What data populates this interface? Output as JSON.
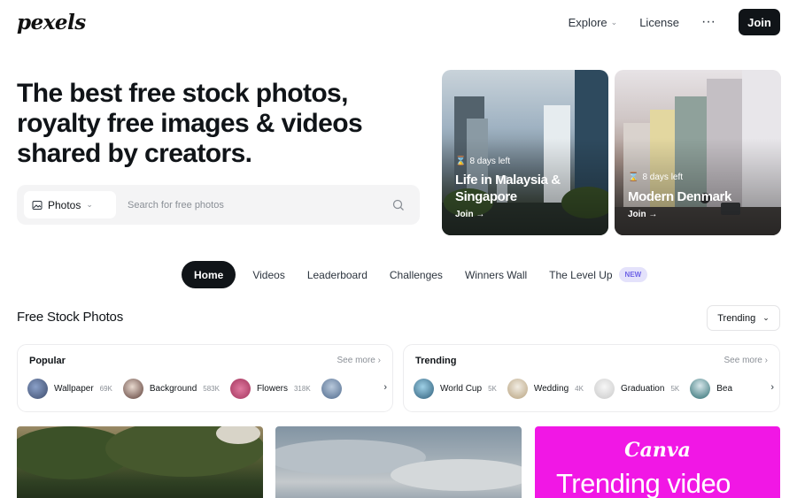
{
  "header": {
    "logo": "pexels",
    "nav": {
      "explore": "Explore",
      "license": "License",
      "more": "···",
      "join": "Join"
    }
  },
  "hero": {
    "title": "The best free stock photos, royalty free images & videos shared by creators.",
    "search": {
      "type": "Photos",
      "placeholder": "Search for free photos"
    }
  },
  "promos": [
    {
      "days": "8 days left",
      "title": "Life in Malaysia & Singapore",
      "join": "Join →"
    },
    {
      "days": "8 days left",
      "title": "Modern Denmark",
      "join": "Join →"
    }
  ],
  "tabs": {
    "home": "Home",
    "videos": "Videos",
    "leaderboard": "Leaderboard",
    "challenges": "Challenges",
    "winners": "Winners Wall",
    "levelup": "The Level Up",
    "new_badge": "NEW"
  },
  "section": {
    "title": "Free Stock Photos",
    "sort": "Trending"
  },
  "collections": {
    "popular": {
      "title": "Popular",
      "see_more": "See more",
      "items": [
        {
          "label": "Wallpaper",
          "count": "69K",
          "color": "#3b4a6b"
        },
        {
          "label": "Background",
          "count": "583K",
          "color": "#5a3b35"
        },
        {
          "label": "Flowers",
          "count": "318K",
          "color": "#a2345c"
        },
        {
          "label": "",
          "count": "",
          "color": "#4f6a8d"
        }
      ]
    },
    "trending": {
      "title": "Trending",
      "see_more": "See more",
      "items": [
        {
          "label": "World Cup",
          "count": "5K",
          "color": "#2d5c78"
        },
        {
          "label": "Wedding",
          "count": "4K",
          "color": "#b7a27e"
        },
        {
          "label": "Graduation",
          "count": "5K",
          "color": "#c9c9c9"
        },
        {
          "label": "Bea",
          "count": "",
          "color": "#2f6f73"
        }
      ]
    }
  },
  "tiles": {
    "canva": "Canva",
    "canva_sub": "Trending video"
  }
}
